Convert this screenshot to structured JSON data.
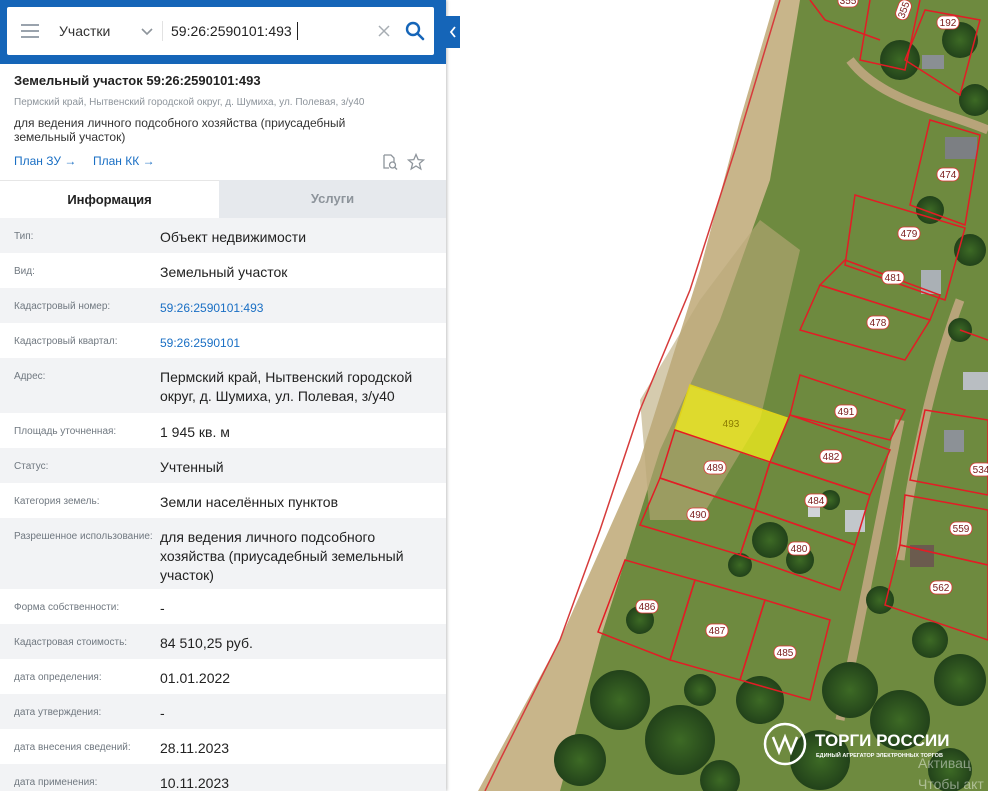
{
  "search": {
    "layer": "Участки",
    "query": "59:26:2590101:493"
  },
  "icons": {
    "menu": "menu-icon",
    "chevron": "chevron-down-icon",
    "clear": "close-icon",
    "search": "search-icon",
    "collapse": "chevron-left-icon",
    "document": "document-search-icon",
    "favorite": "star-icon"
  },
  "parcel": {
    "title": "Земельный участок 59:26:2590101:493",
    "address_line": "Пермский край, Нытвенский городской округ, д. Шумиха, ул. Полевая, з/у40",
    "purpose": "для ведения личного подсобного хозяйства (приусадебный земельный участок)",
    "links": [
      {
        "label": "План ЗУ →"
      },
      {
        "label": "План КК →"
      }
    ]
  },
  "tabs": [
    {
      "label": "Информация",
      "active": true
    },
    {
      "label": "Услуги",
      "active": false
    }
  ],
  "info": [
    {
      "key": "Тип:",
      "value": "Объект недвижимости"
    },
    {
      "key": "Вид:",
      "value": "Земельный участок"
    },
    {
      "key": "Кадастровый номер:",
      "value": "59:26:2590101:493",
      "link": true
    },
    {
      "key": "Кадастровый квартал:",
      "value": "59:26:2590101",
      "link": true
    },
    {
      "key": "Адрес:",
      "value": "Пермский край, Нытвенский городской округ, д. Шумиха, ул. Полевая, з/у40"
    },
    {
      "key": "Площадь уточненная:",
      "value": "1 945 кв. м"
    },
    {
      "key": "Статус:",
      "value": "Учтенный"
    },
    {
      "key": "Категория земель:",
      "value": "Земли населённых пунктов"
    },
    {
      "key": "Разрешенное использование:",
      "value": "для ведения личного подсобного хозяйства (приусадебный земельный участок)"
    },
    {
      "key": "Форма собственности:",
      "value": "-"
    },
    {
      "key": "Кадастровая стоимость:",
      "value": "84 510,25 руб."
    },
    {
      "key": "дата определения:",
      "value": "01.01.2022"
    },
    {
      "key": "дата утверждения:",
      "value": "-"
    },
    {
      "key": "дата внесения сведений:",
      "value": "28.11.2023"
    },
    {
      "key": "дата применения:",
      "value": "10.11.2023"
    }
  ],
  "map": {
    "selected_parcel": "493",
    "parcel_labels": [
      "355",
      "355",
      "192",
      "474",
      "479",
      "481",
      "478",
      "491",
      "482",
      "489",
      "484",
      "490",
      "480",
      "486",
      "487",
      "485",
      "559",
      "562",
      "534"
    ],
    "colors": {
      "parcel_border": "#e31c25",
      "selected_fill": "#f4ef1c",
      "header": "#1565b8",
      "link": "#1a6fc4"
    }
  },
  "watermark": {
    "brand": "ТОРГИ РОССИИ",
    "tagline": "ЕДИНЫЙ АГРЕГАТОР ЭЛЕКТРОННЫХ ТОРГОВ",
    "activation": [
      "Активац",
      "Чтобы акт"
    ]
  }
}
